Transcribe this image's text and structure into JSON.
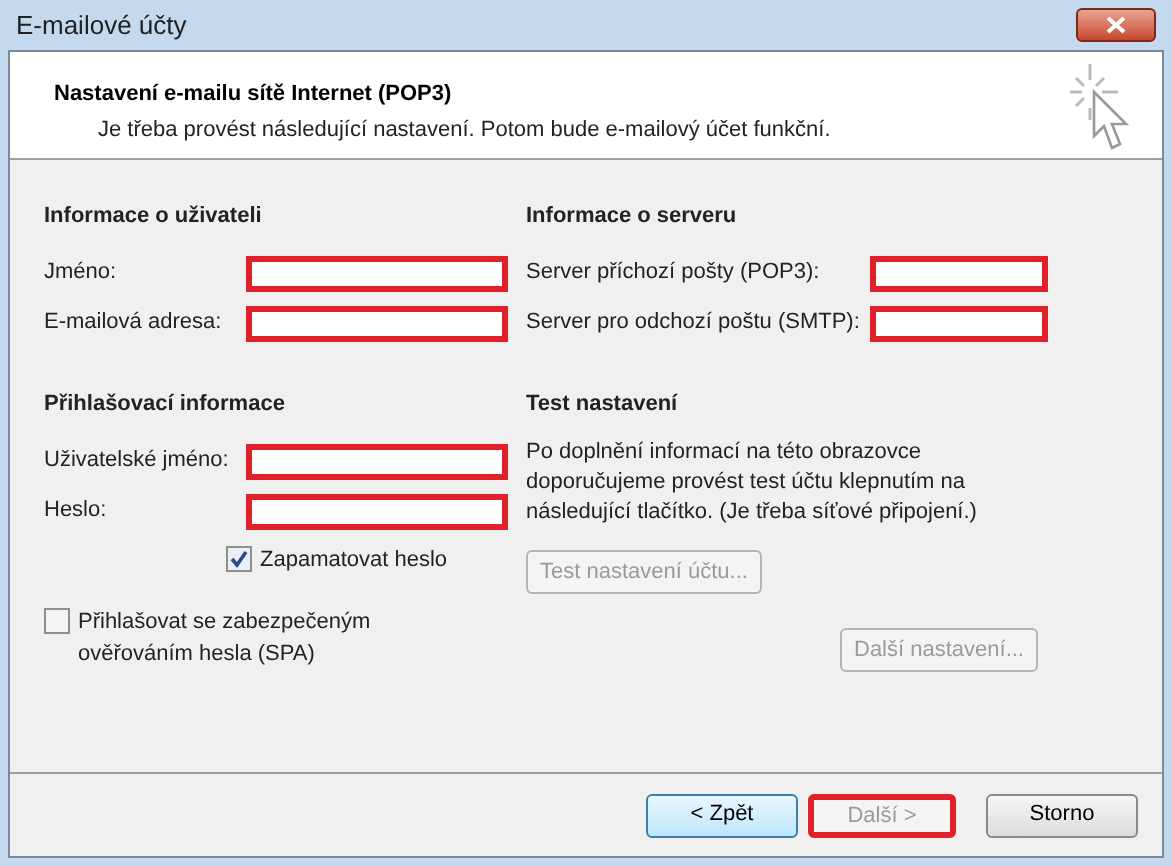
{
  "window": {
    "title": "E-mailové účty"
  },
  "header": {
    "title": "Nastavení e-mailu sítě Internet (POP3)",
    "subtitle": "Je třeba provést následující nastavení. Potom bude e-mailový účet funkční."
  },
  "user_info": {
    "heading": "Informace o uživateli",
    "fields": [
      {
        "label": "Jméno:",
        "highlighted": true
      },
      {
        "label": "E-mailová adresa:",
        "highlighted": true
      }
    ]
  },
  "server_info": {
    "heading": "Informace o serveru",
    "fields": [
      {
        "label": "Server příchozí pošty (POP3):",
        "highlighted": true
      },
      {
        "label": "Server pro odchozí poštu (SMTP):",
        "highlighted": true
      }
    ]
  },
  "login_info": {
    "heading": "Přihlašovací informace",
    "fields": [
      {
        "label": "Uživatelské jméno:",
        "highlighted": true
      },
      {
        "label": "Heslo:",
        "highlighted": true
      }
    ],
    "remember": {
      "label": "Zapamatovat heslo",
      "checked": true
    },
    "spa": {
      "label": "Přihlašovat se zabezpečeným ověřováním hesla (SPA)",
      "checked": false
    }
  },
  "test": {
    "heading": "Test nastavení",
    "text": "Po doplnění informací na této obrazovce doporučujeme provést test účtu klepnutím na následující tlačítko. (Je třeba síťové připojení.)",
    "button": {
      "label": "Test nastavení účtu...",
      "disabled": true
    }
  },
  "more_button": {
    "label": "Další nastavení...",
    "disabled": true
  },
  "buttons": [
    {
      "label": "< Zpět",
      "disabled": false,
      "highlighted": false,
      "focused": true
    },
    {
      "label": "Další >",
      "disabled": true,
      "highlighted": true,
      "focused": false
    },
    {
      "label": "Storno",
      "disabled": false,
      "highlighted": false,
      "focused": false
    }
  ]
}
